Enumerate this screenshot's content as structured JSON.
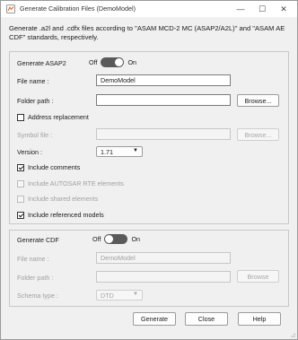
{
  "window": {
    "title": "Generate Calibration Files (DemoModel)",
    "minimize": "—",
    "maximize": "☐",
    "close": "✕"
  },
  "intro": "Generate .a2l and .cdfx files according to \"ASAM MCD-2 MC (ASAP2/A2L)\" and \"ASAM AE CDF\" standards, respectively.",
  "asap2": {
    "heading": "Generate ASAP2",
    "toggle_off": "Off",
    "toggle_on": "On",
    "toggle_state": "on",
    "file_name_label": "File name :",
    "file_name_value": "DemoModel",
    "folder_path_label": "Folder path :",
    "folder_path_value": "",
    "browse_label": "Browse...",
    "address_replacement_label": "Address replacement",
    "address_replacement_checked": false,
    "symbol_file_label": "Symbol file :",
    "symbol_file_value": "",
    "symbol_browse_label": "Browse...",
    "version_label": "Version :",
    "version_value": "1.71",
    "include_comments_label": "Include comments",
    "include_comments_checked": true,
    "include_autosar_label": "Include AUTOSAR RTE elements",
    "include_autosar_checked": false,
    "include_shared_label": "Include shared elements",
    "include_shared_checked": false,
    "include_referenced_label": "Include referenced models",
    "include_referenced_checked": true
  },
  "cdf": {
    "heading": "Generate CDF",
    "toggle_off": "Off",
    "toggle_on": "On",
    "toggle_state": "off",
    "file_name_label": "File name :",
    "file_name_value": "DemoModel",
    "folder_path_label": "Folder path :",
    "folder_path_value": "",
    "browse_label": "Browse",
    "schema_type_label": "Schema type :",
    "schema_type_value": "DTD"
  },
  "footer": {
    "generate_label": "Generate",
    "close_label": "Close",
    "help_label": "Help"
  },
  "colors": {
    "window_bg": "#f0f0f0",
    "toggle_track": "#5a5a5a",
    "disabled_text": "#a0a0a0"
  }
}
